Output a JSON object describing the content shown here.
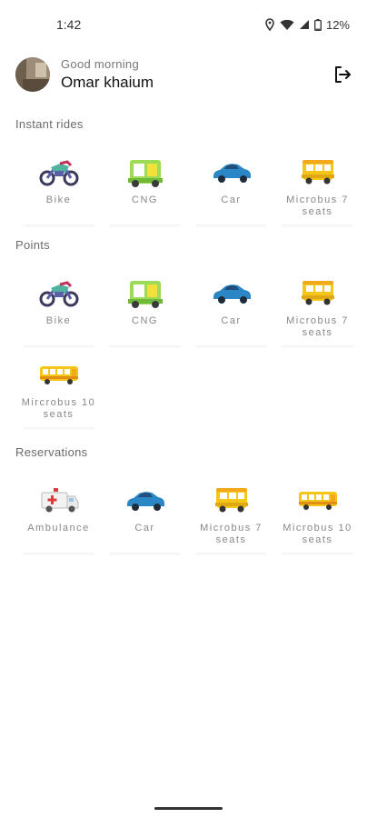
{
  "status": {
    "time": "1:42",
    "battery": "12%"
  },
  "header": {
    "greeting": "Good morning",
    "user_name": "Omar khaium",
    "logout_icon": "logout-icon"
  },
  "sections": {
    "instant": {
      "title": "Instant rides",
      "items": [
        {
          "label": "Bike",
          "icon": "motorbike-icon"
        },
        {
          "label": "CNG",
          "icon": "cng-icon"
        },
        {
          "label": "Car",
          "icon": "car-icon"
        },
        {
          "label": "Microbus 7 seats",
          "icon": "microbus-icon"
        }
      ]
    },
    "points": {
      "title": "Points",
      "items": [
        {
          "label": "Bike",
          "icon": "motorbike-icon"
        },
        {
          "label": "CNG",
          "icon": "cng-icon"
        },
        {
          "label": "Car",
          "icon": "car-icon"
        },
        {
          "label": "Microbus 7 seats",
          "icon": "microbus-icon"
        },
        {
          "label": "Mircrobus 10 seats",
          "icon": "bus-icon"
        }
      ]
    },
    "reservations": {
      "title": "Reservations",
      "items": [
        {
          "label": "Ambulance",
          "icon": "ambulance-icon"
        },
        {
          "label": "Car",
          "icon": "car-icon"
        },
        {
          "label": "Microbus 7 seats",
          "icon": "microbus-icon"
        },
        {
          "label": "Microbus 10 seats",
          "icon": "bus-icon"
        }
      ]
    }
  },
  "colors": {
    "bike": "#5a5fa8",
    "cng": "#8dd34a",
    "car": "#2b86c5",
    "microbus": "#f5c518"
  }
}
